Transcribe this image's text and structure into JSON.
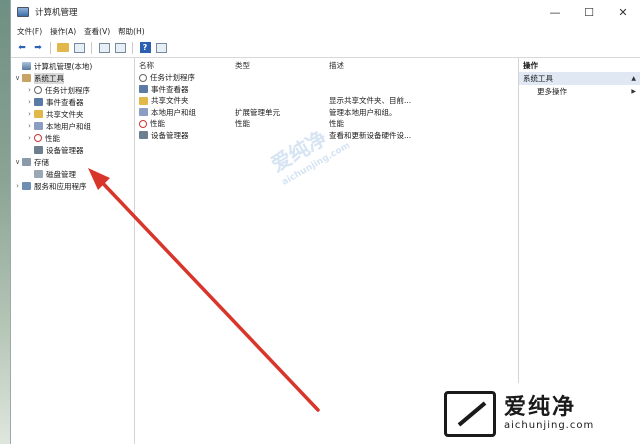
{
  "window": {
    "title": "计算机管理",
    "controls": [
      "—",
      "☐",
      "✕"
    ]
  },
  "menubar": {
    "items": [
      "文件(F)",
      "操作(A)",
      "查看(V)",
      "帮助(H)"
    ]
  },
  "toolbar": {
    "back": "⬅",
    "forward": "➡"
  },
  "tree": {
    "nodes": [
      {
        "label": "计算机管理(本地)",
        "twist": "",
        "indent": 0,
        "icon": "computer-icon"
      },
      {
        "label": "系统工具",
        "twist": "∨",
        "indent": 0,
        "icon": "tools-icon",
        "selected": true
      },
      {
        "label": "任务计划程序",
        "twist": "›",
        "indent": 1,
        "icon": "clock-icon"
      },
      {
        "label": "事件查看器",
        "twist": "›",
        "indent": 1,
        "icon": "event-icon"
      },
      {
        "label": "共享文件夹",
        "twist": "›",
        "indent": 1,
        "icon": "share-icon"
      },
      {
        "label": "本地用户和组",
        "twist": "›",
        "indent": 1,
        "icon": "users-icon"
      },
      {
        "label": "性能",
        "twist": "›",
        "indent": 1,
        "icon": "perf-icon"
      },
      {
        "label": "设备管理器",
        "twist": "",
        "indent": 1,
        "icon": "device-icon"
      },
      {
        "label": "存储",
        "twist": "∨",
        "indent": 0,
        "icon": "storage-icon"
      },
      {
        "label": "磁盘管理",
        "twist": "",
        "indent": 1,
        "icon": "disk-icon"
      },
      {
        "label": "服务和应用程序",
        "twist": "›",
        "indent": 0,
        "icon": "services-icon"
      }
    ]
  },
  "list": {
    "headers": {
      "name": "名称",
      "type": "类型",
      "desc": "描述"
    },
    "rows": [
      {
        "name": "任务计划程序",
        "type": "",
        "desc": "",
        "icon": "clock-icon"
      },
      {
        "name": "事件查看器",
        "type": "",
        "desc": "",
        "icon": "event-icon"
      },
      {
        "name": "共享文件夹",
        "type": "",
        "desc": "显示共享文件夹、目前...",
        "icon": "share-icon"
      },
      {
        "name": "本地用户和组",
        "type": "扩展管理单元",
        "desc": "管理本地用户和组。",
        "icon": "users-icon"
      },
      {
        "name": "性能",
        "type": "性能",
        "desc": "性能",
        "icon": "perf-icon"
      },
      {
        "name": "设备管理器",
        "type": "",
        "desc": "查看和更新设备硬件设...",
        "icon": "device-icon"
      }
    ]
  },
  "actions": {
    "header": "操作",
    "section": "系统工具",
    "item": "更多操作"
  },
  "watermark": {
    "cn": "爱纯净",
    "en": "aichunjing.com",
    "center_cn": "爱纯净",
    "center_en": "aichunjing.com"
  }
}
